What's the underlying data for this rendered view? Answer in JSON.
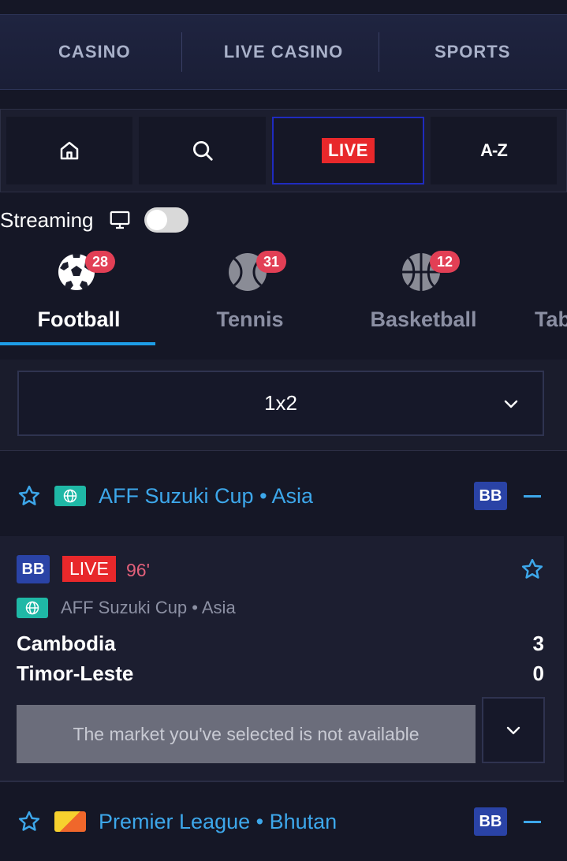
{
  "top_nav": {
    "tabs": [
      "CASINO",
      "LIVE CASINO",
      "SPORTS"
    ]
  },
  "toolbar": {
    "home_icon": "home-icon",
    "search_icon": "search-icon",
    "live_label": "LIVE",
    "az_label": "A-Z"
  },
  "streaming": {
    "label": "Streaming",
    "icon": "monitor-icon",
    "enabled": false
  },
  "sports": [
    {
      "label": "Football",
      "count": "28",
      "icon": "football-icon",
      "active": true
    },
    {
      "label": "Tennis",
      "count": "31",
      "icon": "tennis-ball-icon",
      "active": false
    },
    {
      "label": "Basketball",
      "count": "12",
      "icon": "basketball-icon",
      "active": false
    },
    {
      "label": "Tab",
      "count": "",
      "icon": "",
      "active": false
    }
  ],
  "market": {
    "selected": "1x2"
  },
  "leagues": [
    {
      "name": "AFF Suzuki Cup • Asia",
      "bb": "BB",
      "flag_color": "#1fb8a6"
    },
    {
      "name": "Premier League • Bhutan",
      "bb": "BB",
      "flag_color": "#f4a12a"
    }
  ],
  "match": {
    "bb": "BB",
    "live": "LIVE",
    "minute": "96'",
    "league": "AFF Suzuki Cup • Asia",
    "home_team": "Cambodia",
    "home_score": "3",
    "away_team": "Timor-Leste",
    "away_score": "0",
    "unavailable_message": "The market you've selected is not available"
  },
  "colors": {
    "accent": "#1e9de6",
    "live_red": "#e8282b",
    "badge_red": "#e23f55",
    "bb_blue": "#2a43a6"
  }
}
